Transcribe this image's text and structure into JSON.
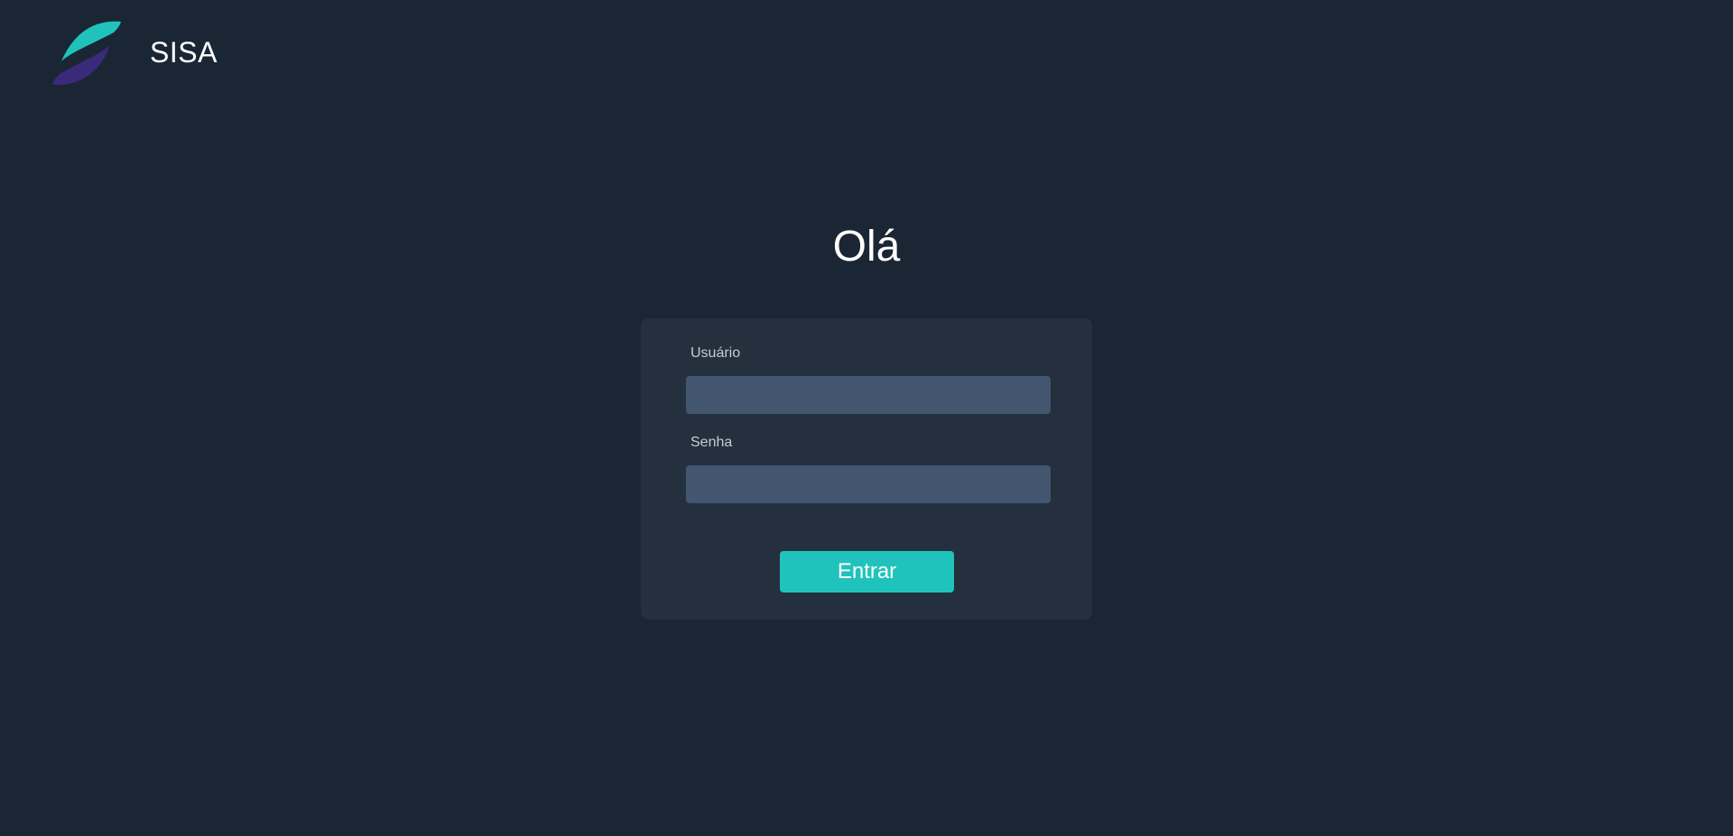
{
  "brand": {
    "name": "SISA",
    "logo_colors": {
      "top_leaf": "#20c3bb",
      "bottom_leaf": "#3a2a7a"
    }
  },
  "greeting": "Olá",
  "login_form": {
    "username_label": "Usuário",
    "username_value": "",
    "password_label": "Senha",
    "password_value": "",
    "submit_label": "Entrar"
  },
  "colors": {
    "background": "#1a2634",
    "card": "#24303e",
    "input": "#435670",
    "accent": "#20c3bb"
  }
}
